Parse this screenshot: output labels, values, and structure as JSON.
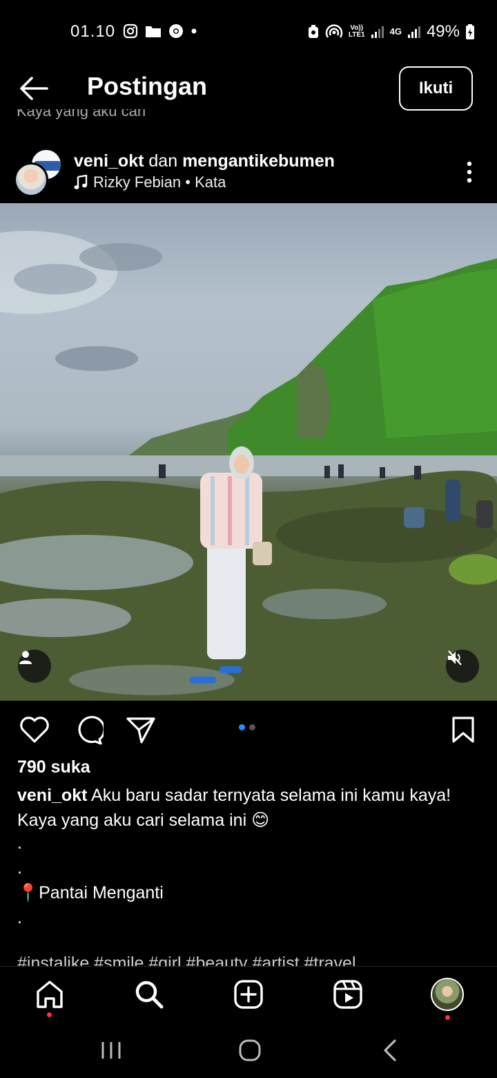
{
  "status_bar": {
    "time": "01.10",
    "network_top": "Vo))",
    "network_bottom": "LTE1",
    "network2": "4G",
    "battery": "49%"
  },
  "header": {
    "title": "Postingan",
    "follow_label": "Ikuti",
    "prev_caption_fragment": "Kaya yang aku cari"
  },
  "post": {
    "user1": "veni_okt",
    "connector": "dan",
    "user2": "mengantikebumen",
    "music": "Rizky Febian • Kata",
    "carousel": {
      "count": 2,
      "active_index": 0
    }
  },
  "engagement": {
    "likes": "790 suka"
  },
  "caption": {
    "author": "veni_okt",
    "text": "Aku baru sadar ternyata selama ini kamu kaya! Kaya yang aku cari selama ini 😊",
    "line_dot1": ".",
    "line_dot2": ".",
    "location": "📍Pantai Menganti",
    "line_dot3": ".",
    "hashtags": "#instalike #smile #girl #beauty #artist #travel"
  },
  "colors": {
    "accent_blue": "#1e90ff",
    "notification_red": "#ff3040"
  },
  "icons": {
    "back": "arrow-left-icon",
    "more": "more-vertical-icon",
    "like": "heart-icon",
    "comment": "comment-icon",
    "share": "send-icon",
    "save": "bookmark-icon",
    "home": "home-icon",
    "search": "search-icon",
    "create": "plus-square-icon",
    "reels": "reels-icon"
  }
}
